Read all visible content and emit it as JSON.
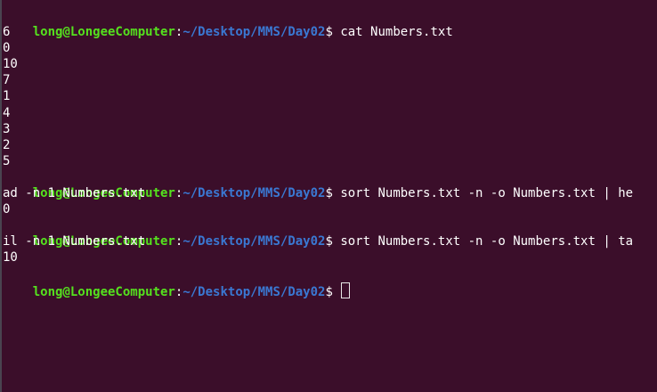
{
  "prompt": {
    "user": "long@LongeeComputer",
    "colon": ":",
    "path": "~/Desktop/MMS/Day02",
    "dollar": "$ "
  },
  "lines": [
    {
      "type": "prompt",
      "cmd": "cat Numbers.txt"
    },
    {
      "type": "out",
      "text": "6"
    },
    {
      "type": "out",
      "text": "0"
    },
    {
      "type": "out",
      "text": "10"
    },
    {
      "type": "out",
      "text": "7"
    },
    {
      "type": "out",
      "text": "1"
    },
    {
      "type": "out",
      "text": "4"
    },
    {
      "type": "out",
      "text": "3"
    },
    {
      "type": "out",
      "text": "2"
    },
    {
      "type": "out",
      "text": "5"
    },
    {
      "type": "prompt",
      "cmd": "sort Numbers.txt -n -o Numbers.txt | he"
    },
    {
      "type": "out",
      "text": "ad -n 1 Numbers.txt"
    },
    {
      "type": "out",
      "text": "0"
    },
    {
      "type": "prompt",
      "cmd": "sort Numbers.txt -n -o Numbers.txt | ta"
    },
    {
      "type": "out",
      "text": "il -n 1 Numbers.txt"
    },
    {
      "type": "out",
      "text": "10"
    },
    {
      "type": "prompt",
      "cmd": "",
      "cursor": true
    }
  ],
  "colors": {
    "background": "#3b0e2a",
    "user": "#55e11e",
    "path": "#3a78d2",
    "text": "#ffffff"
  }
}
